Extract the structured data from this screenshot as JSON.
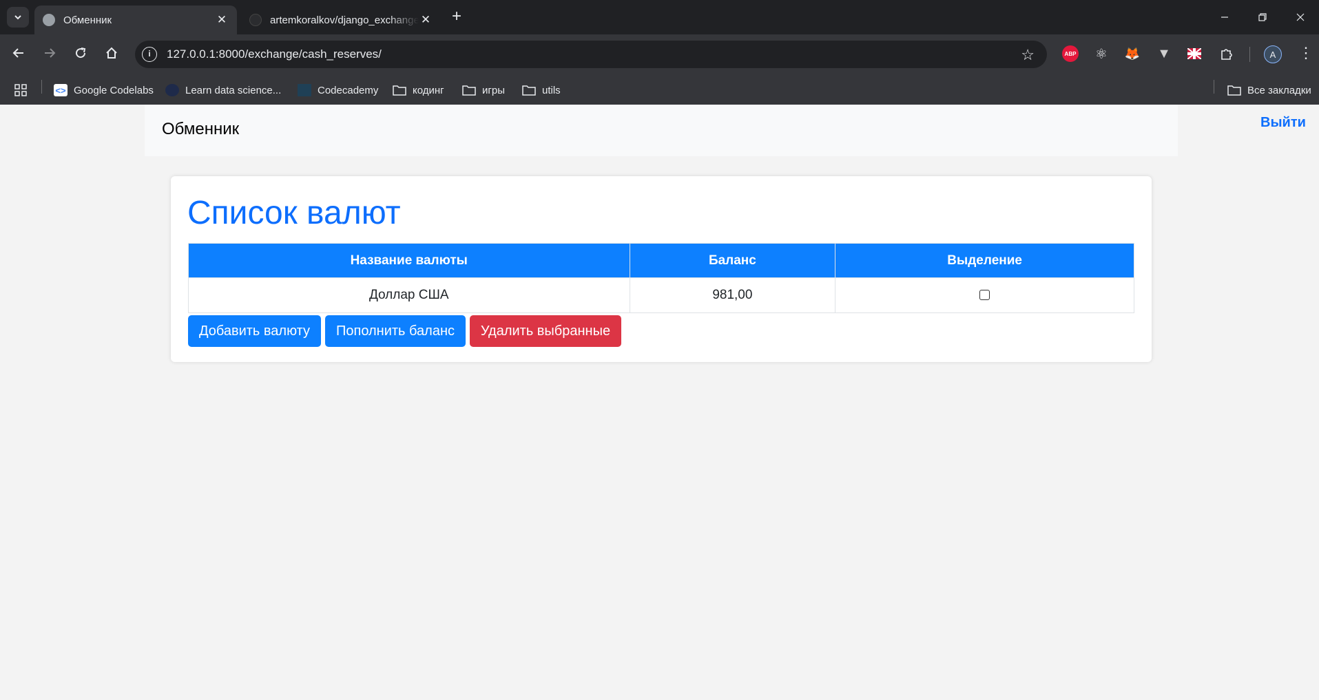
{
  "browser": {
    "tabs": [
      {
        "title": "Обменник",
        "active": true
      },
      {
        "title": "artemkoralkov/django_exchange",
        "active": false
      }
    ],
    "url": "127.0.0.1:8000/exchange/cash_reserves/",
    "extensions": {
      "abp": "ABP"
    },
    "profile_initial": "A",
    "bookmarks": [
      {
        "label": "Google Codelabs"
      },
      {
        "label": "Learn data science..."
      },
      {
        "label": "Codecademy"
      },
      {
        "label": "кодинг"
      },
      {
        "label": "игры"
      },
      {
        "label": "utils"
      }
    ],
    "all_bookmarks": "Все закладки"
  },
  "site": {
    "brand": "Обменник",
    "logout": "Выйти"
  },
  "main": {
    "title": "Список валют",
    "table": {
      "headers": [
        "Название валюты",
        "Баланс",
        "Выделение"
      ],
      "rows": [
        {
          "name": "Доллар США",
          "balance": "981,00",
          "selected": false
        }
      ]
    },
    "buttons": {
      "add": "Добавить валюту",
      "topup": "Пополнить баланс",
      "delete": "Удалить выбранные"
    }
  },
  "colors": {
    "primary": "#0d80ff",
    "danger": "#dc3545",
    "link": "#0d6efd"
  }
}
